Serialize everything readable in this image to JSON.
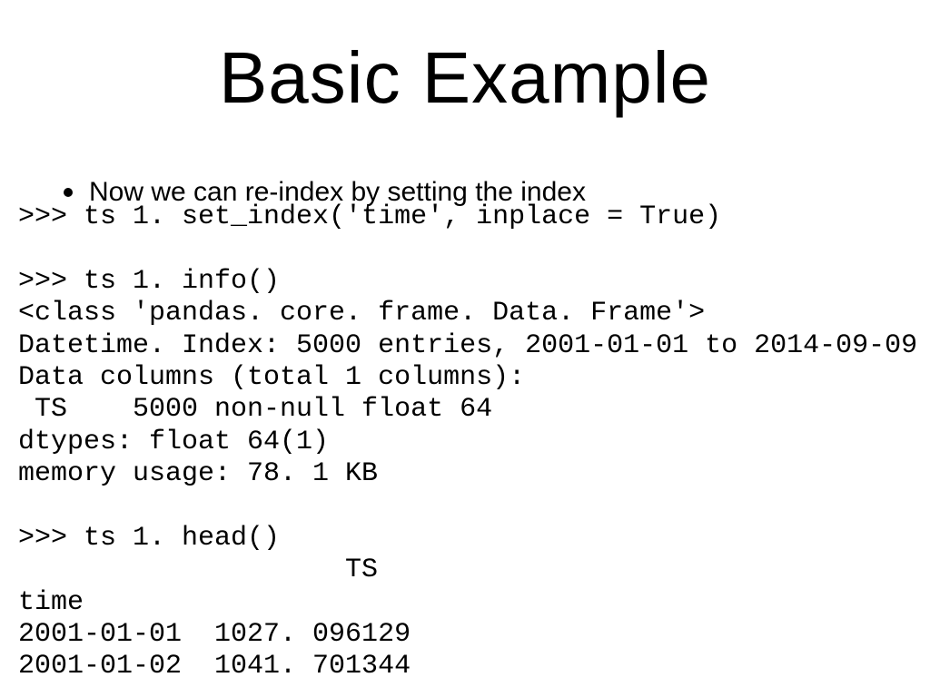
{
  "slide": {
    "title": "Basic Example",
    "bullet": "Now we can re-index by setting the index",
    "code": ">>> ts 1. set_index('time', inplace = True)\n\n>>> ts 1. info()\n<class 'pandas. core. frame. Data. Frame'>\nDatetime. Index: 5000 entries, 2001-01-01 to 2014-09-09\nData columns (total 1 columns):\n TS    5000 non-null float 64\ndtypes: float 64(1)\nmemory usage: 78. 1 KB\n\n>>> ts 1. head()\n                    TS\ntime\n2001-01-01  1027. 096129\n2001-01-02  1041. 701344"
  }
}
